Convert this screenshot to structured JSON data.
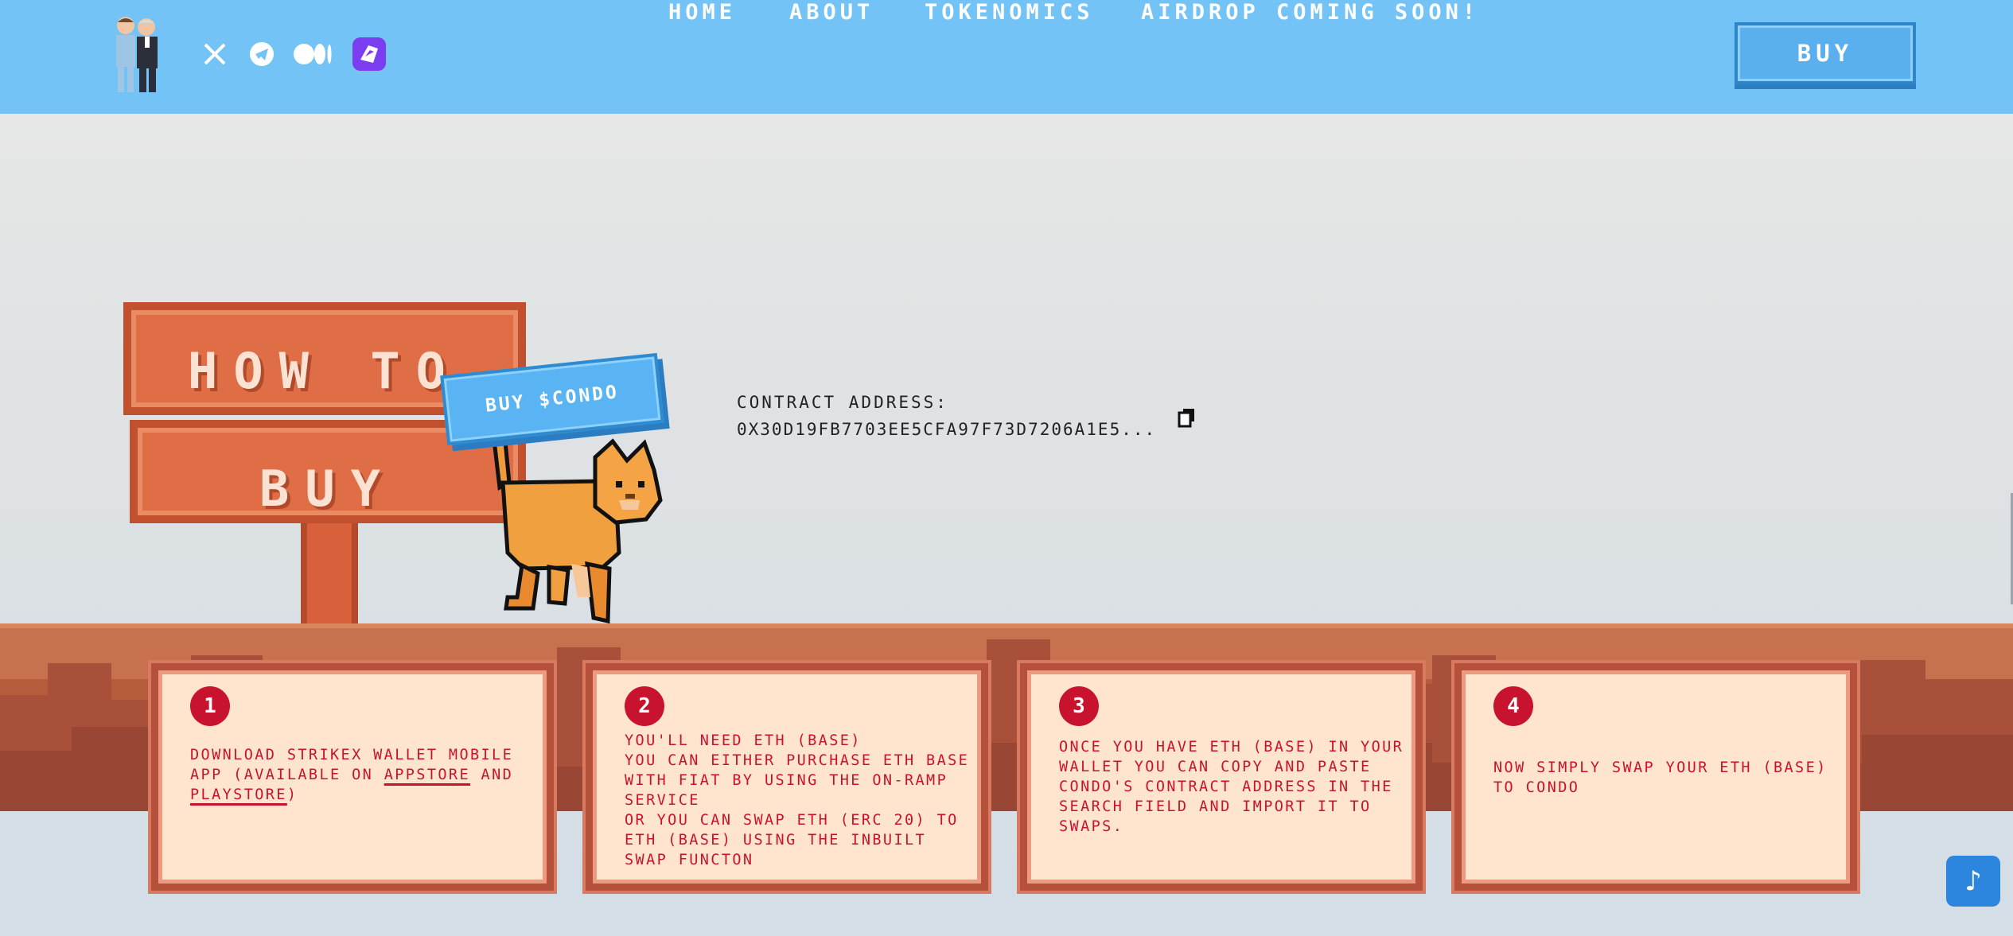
{
  "header": {
    "nav": [
      "HOME",
      "ABOUT",
      "TOKENOMICS",
      "AIRDROP COMING SOON!"
    ],
    "buy_label": "BUY",
    "social_icons": [
      "x-icon",
      "telegram-icon",
      "medium-icon",
      "dextools-icon"
    ]
  },
  "sign": {
    "line1": "HOW TO",
    "line2": "BUY",
    "tag": "BUY $CONDO"
  },
  "contract": {
    "label": "CONTRACT ADDRESS:",
    "address": "0X30D19FB7703EE5CFA97F73D7206A1E5..."
  },
  "steps": [
    {
      "number": "1",
      "text_before": "DOWNLOAD STRIKEX WALLET MOBILE APP (AVAILABLE ON ",
      "link1": "APPSTORE",
      "middle": " AND ",
      "link2": "PLAYSTORE",
      "text_after": ")"
    },
    {
      "number": "2",
      "lines": [
        "YOU'LL NEED ETH (BASE)",
        "YOU CAN EITHER PURCHASE ETH BASE WITH FIAT BY USING THE ON-RAMP SERVICE",
        "OR YOU CAN SWAP ETH (ERC 20) TO ETH (BASE) USING THE INBUILT SWAP FUNCTON"
      ]
    },
    {
      "number": "3",
      "text": "ONCE YOU HAVE ETH (BASE) IN YOUR WALLET YOU CAN COPY AND PASTE CONDO'S CONTRACT ADDRESS IN THE SEARCH FIELD AND IMPORT IT TO SWAPS."
    },
    {
      "number": "4",
      "text": "NOW SIMPLY SWAP YOUR ETH (BASE) TO CONDO"
    }
  ],
  "music_icon": "♪",
  "colors": {
    "header_bg": "#74c3f6",
    "button_blue": "#5ab0ee",
    "card_bg": "#ffe5cd",
    "card_border": "#b5513a",
    "step_red": "#c8132f",
    "ground": "#c8714e"
  }
}
